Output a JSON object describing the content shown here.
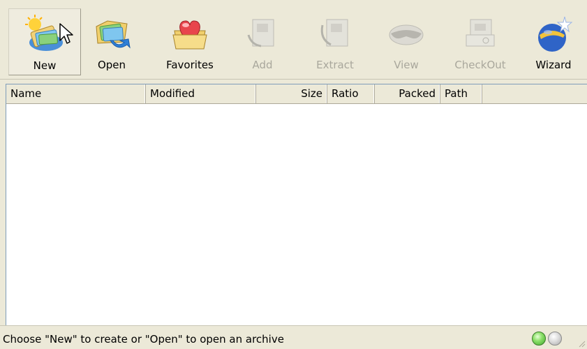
{
  "toolbar": {
    "buttons": [
      {
        "label": "New",
        "icon": "new-archive-icon",
        "enabled": true
      },
      {
        "label": "Open",
        "icon": "open-archive-icon",
        "enabled": true
      },
      {
        "label": "Favorites",
        "icon": "favorites-icon",
        "enabled": true
      },
      {
        "label": "Add",
        "icon": "add-files-icon",
        "enabled": false
      },
      {
        "label": "Extract",
        "icon": "extract-icon",
        "enabled": false
      },
      {
        "label": "View",
        "icon": "view-icon",
        "enabled": false
      },
      {
        "label": "CheckOut",
        "icon": "checkout-icon",
        "enabled": false
      },
      {
        "label": "Wizard",
        "icon": "wizard-icon",
        "enabled": true
      }
    ]
  },
  "file_list": {
    "columns": [
      {
        "label": "Name"
      },
      {
        "label": "Modified"
      },
      {
        "label": "Size"
      },
      {
        "label": "Ratio"
      },
      {
        "label": "Packed"
      },
      {
        "label": "Path"
      }
    ],
    "rows": []
  },
  "status_bar": {
    "text": "Choose \"New\" to create or \"Open\" to open an archive",
    "indicators": [
      {
        "icon": "status-led-green-icon",
        "color": "#5cc23f"
      },
      {
        "icon": "status-led-gray-icon",
        "color": "#c9c9c9"
      }
    ]
  },
  "colors": {
    "window_bg": "#ece9d8",
    "list_bg": "#ffffff",
    "disabled_text": "#a9a79c"
  }
}
